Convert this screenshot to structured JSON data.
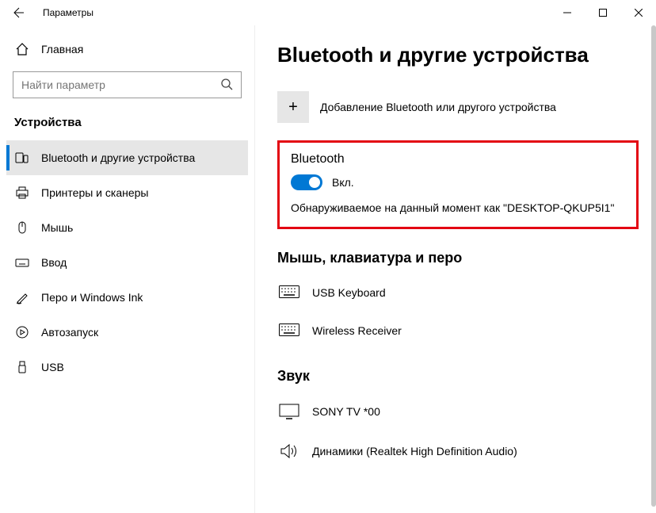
{
  "window": {
    "title": "Параметры"
  },
  "sidebar": {
    "home": "Главная",
    "search_placeholder": "Найти параметр",
    "category": "Устройства",
    "items": [
      {
        "label": "Bluetooth и другие устройства",
        "active": true
      },
      {
        "label": "Принтеры и сканеры",
        "active": false
      },
      {
        "label": "Мышь",
        "active": false
      },
      {
        "label": "Ввод",
        "active": false
      },
      {
        "label": "Перо и Windows Ink",
        "active": false
      },
      {
        "label": "Автозапуск",
        "active": false
      },
      {
        "label": "USB",
        "active": false
      }
    ]
  },
  "main": {
    "title": "Bluetooth и другие устройства",
    "add_device": "Добавление Bluetooth или другого устройства",
    "bt": {
      "heading": "Bluetooth",
      "state": "Вкл.",
      "discoverable": "Обнаруживаемое на данный момент как \"DESKTOP-QKUP5I1\""
    },
    "sections": [
      {
        "heading": "Мышь, клавиатура и перо",
        "devices": [
          {
            "name": "USB Keyboard",
            "kind": "keyboard"
          },
          {
            "name": "Wireless Receiver",
            "kind": "keyboard"
          }
        ]
      },
      {
        "heading": "Звук",
        "devices": [
          {
            "name": "SONY TV  *00",
            "kind": "monitor"
          },
          {
            "name": "Динамики (Realtek High Definition Audio)",
            "kind": "speaker"
          }
        ]
      }
    ]
  }
}
